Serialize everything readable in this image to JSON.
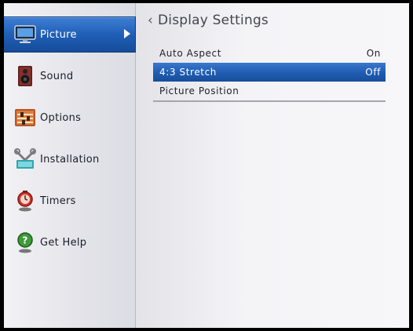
{
  "sidebar": {
    "items": [
      {
        "label": "Picture",
        "icon": "tv-icon",
        "active": true
      },
      {
        "label": "Sound",
        "icon": "speaker-icon",
        "active": false
      },
      {
        "label": "Options",
        "icon": "options-icon",
        "active": false
      },
      {
        "label": "Installation",
        "icon": "installation-icon",
        "active": false
      },
      {
        "label": "Timers",
        "icon": "timer-icon",
        "active": false
      },
      {
        "label": "Get Help",
        "icon": "help-icon",
        "active": false
      }
    ]
  },
  "main": {
    "title": "Display Settings",
    "back_glyph": "‹",
    "menu": [
      {
        "label": "Auto Aspect",
        "value": "On"
      },
      {
        "label": "4:3 Stretch",
        "value": "Off",
        "selected": true
      },
      {
        "label": "Picture Position",
        "value": ""
      }
    ]
  },
  "colors": {
    "highlight": "#1f5cb2",
    "sidebar_bg": "#e4e4ea",
    "text": "#1e1e28"
  }
}
